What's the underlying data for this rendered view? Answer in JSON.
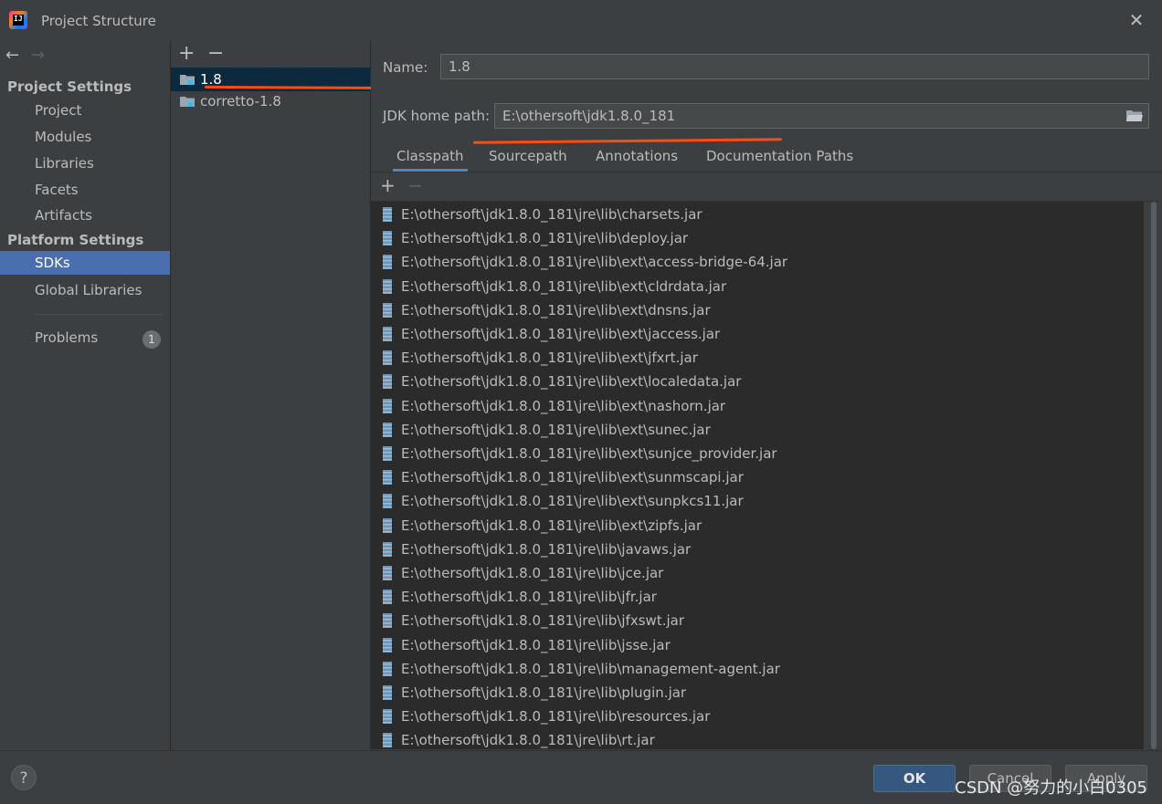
{
  "window": {
    "title": "Project Structure",
    "close_label": "✕"
  },
  "nav": {
    "back": "←",
    "forward": "→"
  },
  "left": {
    "project_settings_header": "Project Settings",
    "project_items": [
      "Project",
      "Modules",
      "Libraries",
      "Facets",
      "Artifacts"
    ],
    "platform_settings_header": "Platform Settings",
    "platform_items": [
      "SDKs",
      "Global Libraries"
    ],
    "selected": "SDKs",
    "problems_label": "Problems",
    "problems_count": "1"
  },
  "sdk_list": {
    "add": "+",
    "remove": "−",
    "items": [
      "1.8",
      "corretto-1.8"
    ],
    "selected": "1.8"
  },
  "detail": {
    "name_label": "Name:",
    "name_value": "1.8",
    "jdk_home_label": "JDK home path:",
    "jdk_home_value": "E:\\othersoft\\jdk1.8.0_181",
    "tabs": [
      "Classpath",
      "Sourcepath",
      "Annotations",
      "Documentation Paths"
    ],
    "active_tab": "Classpath",
    "list_add": "+",
    "list_remove": "−",
    "classpath": [
      "E:\\othersoft\\jdk1.8.0_181\\jre\\lib\\charsets.jar",
      "E:\\othersoft\\jdk1.8.0_181\\jre\\lib\\deploy.jar",
      "E:\\othersoft\\jdk1.8.0_181\\jre\\lib\\ext\\access-bridge-64.jar",
      "E:\\othersoft\\jdk1.8.0_181\\jre\\lib\\ext\\cldrdata.jar",
      "E:\\othersoft\\jdk1.8.0_181\\jre\\lib\\ext\\dnsns.jar",
      "E:\\othersoft\\jdk1.8.0_181\\jre\\lib\\ext\\jaccess.jar",
      "E:\\othersoft\\jdk1.8.0_181\\jre\\lib\\ext\\jfxrt.jar",
      "E:\\othersoft\\jdk1.8.0_181\\jre\\lib\\ext\\localedata.jar",
      "E:\\othersoft\\jdk1.8.0_181\\jre\\lib\\ext\\nashorn.jar",
      "E:\\othersoft\\jdk1.8.0_181\\jre\\lib\\ext\\sunec.jar",
      "E:\\othersoft\\jdk1.8.0_181\\jre\\lib\\ext\\sunjce_provider.jar",
      "E:\\othersoft\\jdk1.8.0_181\\jre\\lib\\ext\\sunmscapi.jar",
      "E:\\othersoft\\jdk1.8.0_181\\jre\\lib\\ext\\sunpkcs11.jar",
      "E:\\othersoft\\jdk1.8.0_181\\jre\\lib\\ext\\zipfs.jar",
      "E:\\othersoft\\jdk1.8.0_181\\jre\\lib\\javaws.jar",
      "E:\\othersoft\\jdk1.8.0_181\\jre\\lib\\jce.jar",
      "E:\\othersoft\\jdk1.8.0_181\\jre\\lib\\jfr.jar",
      "E:\\othersoft\\jdk1.8.0_181\\jre\\lib\\jfxswt.jar",
      "E:\\othersoft\\jdk1.8.0_181\\jre\\lib\\jsse.jar",
      "E:\\othersoft\\jdk1.8.0_181\\jre\\lib\\management-agent.jar",
      "E:\\othersoft\\jdk1.8.0_181\\jre\\lib\\plugin.jar",
      "E:\\othersoft\\jdk1.8.0_181\\jre\\lib\\resources.jar",
      "E:\\othersoft\\jdk1.8.0_181\\jre\\lib\\rt.jar"
    ]
  },
  "footer": {
    "help": "?",
    "ok": "OK",
    "cancel": "Cancel",
    "apply": "Apply",
    "watermark": "CSDN @努力的小白0305"
  },
  "colors": {
    "background": "#3c3f41",
    "list_background": "#2b2b2b",
    "selection": "#4b6eaf",
    "primary_button": "#365880",
    "annotation_underline": "#ff4b12"
  }
}
